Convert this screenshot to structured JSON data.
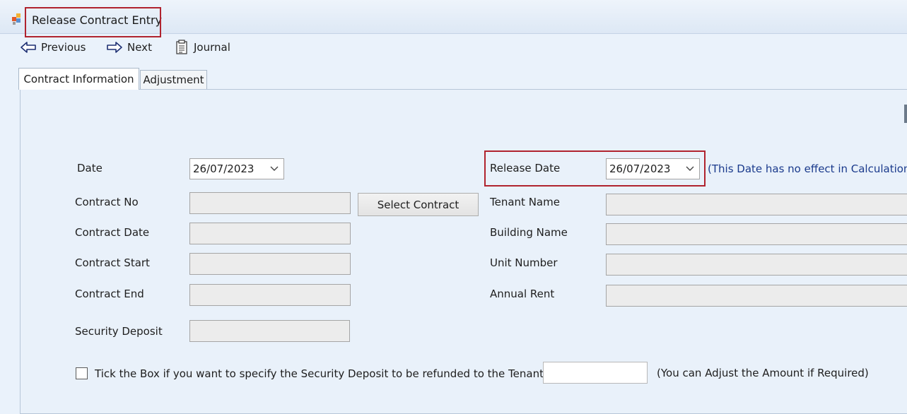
{
  "window": {
    "title": "Release Contract Entry",
    "icon": "app-form-icon"
  },
  "toolbar": {
    "previous_label": "Previous",
    "next_label": "Next",
    "journal_label": "Journal"
  },
  "tabs": [
    {
      "label": "Contract Information",
      "active": true
    },
    {
      "label": "Adjustment",
      "active": false
    }
  ],
  "form": {
    "date_label": "Date",
    "date_value": "26/07/2023",
    "release_date_label": "Release Date",
    "release_date_value": "26/07/2023",
    "release_date_note": "(This Date has no effect in Calculation)",
    "contract_no_label": "Contract No",
    "contract_no_value": "",
    "select_contract_label": "Select Contract",
    "contract_date_label": "Contract Date",
    "contract_date_value": "",
    "contract_start_label": "Contract Start",
    "contract_start_value": "",
    "contract_end_label": "Contract End",
    "contract_end_value": "",
    "security_deposit_label": "Security Deposit",
    "security_deposit_value": "",
    "tenant_name_label": "Tenant Name",
    "tenant_name_value": "",
    "building_name_label": "Building Name",
    "building_name_value": "",
    "unit_number_label": "Unit Number",
    "unit_number_value": "",
    "annual_rent_label": "Annual Rent",
    "annual_rent_value": "",
    "refund_checkbox_label": "Tick the Box if you want to specify the Security Deposit to  be refunded to the Tenant",
    "refund_checked": false,
    "refund_amount_value": "",
    "refund_note": "(You can Adjust the Amount if Required)"
  },
  "colors": {
    "highlight": "#b0232e",
    "note_text": "#1a3a8c",
    "background": "#eaf2fb"
  }
}
